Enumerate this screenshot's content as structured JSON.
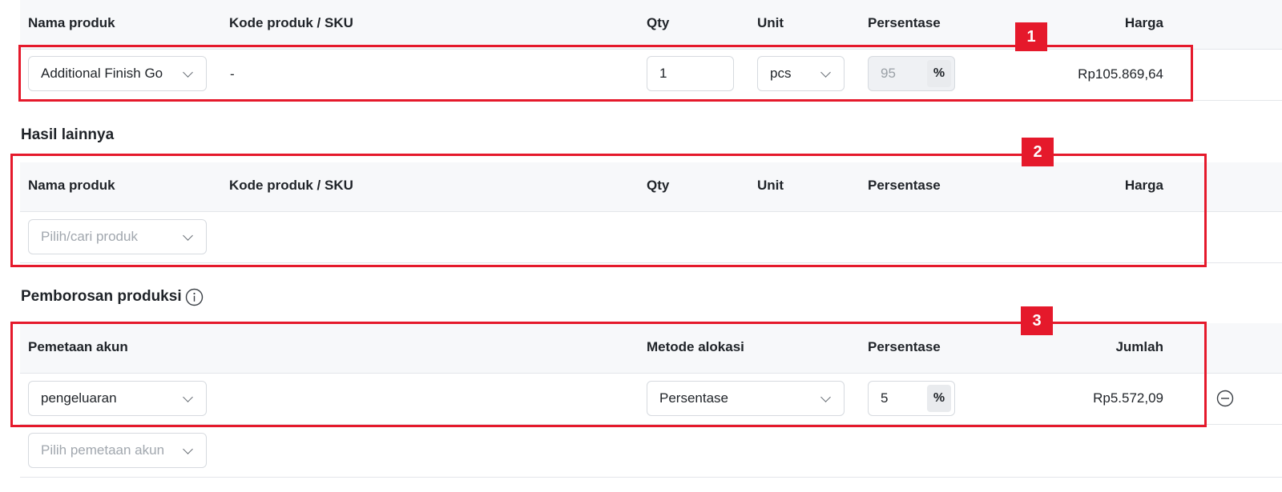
{
  "headers": {
    "product_name": "Nama produk",
    "sku": "Kode produk / SKU",
    "qty": "Qty",
    "unit": "Unit",
    "percentage": "Persentase",
    "price": "Harga"
  },
  "main_product": {
    "product_value": "Additional Finish Go",
    "sku": "-",
    "qty": "1",
    "unit": "pcs",
    "percentage": "95",
    "percent_symbol": "%",
    "price": "Rp105.869,64"
  },
  "other_results": {
    "title": "Hasil lainnya",
    "product_placeholder": "Pilih/cari produk"
  },
  "waste": {
    "title": "Pemborosan produksi",
    "info_icon": "info-icon",
    "headers": {
      "account_mapping": "Pemetaan akun",
      "allocation_method": "Metode alokasi",
      "percentage": "Persentase",
      "amount": "Jumlah"
    },
    "row": {
      "account": "pengeluaran",
      "method": "Persentase",
      "percentage": "5",
      "percent_symbol": "%",
      "amount": "Rp5.572,09",
      "remove_icon": "minus-circle-icon"
    },
    "account_placeholder": "Pilih pemetaan akun"
  },
  "annotations": [
    "1",
    "2",
    "3"
  ],
  "colors": {
    "annotation_red": "#e5192b",
    "header_bg": "#f7f8fa"
  }
}
